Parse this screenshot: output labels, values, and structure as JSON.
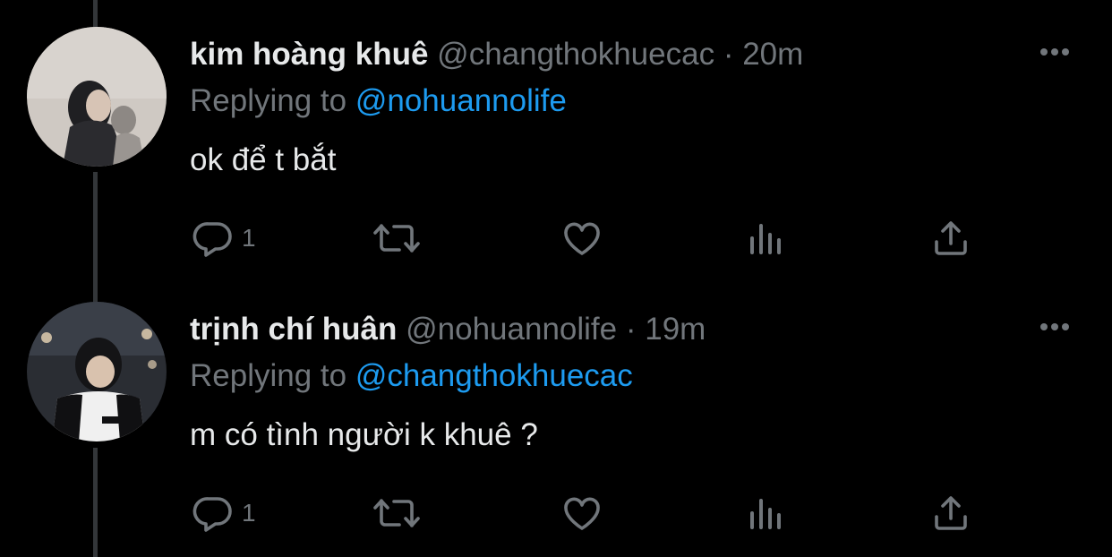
{
  "tweets": [
    {
      "name": "kim hoàng khuê",
      "handle": "@changthokhuecac",
      "separator": "·",
      "time": "20m",
      "replying_prefix": "Replying to",
      "replying_to": "@nohuannolife",
      "text": "ok để t bắt",
      "reply_count": "1",
      "icons": {
        "more": "more-icon",
        "reply": "reply-icon",
        "retweet": "retweet-icon",
        "like": "heart-icon",
        "analytics": "analytics-icon",
        "share": "share-icon"
      }
    },
    {
      "name": "trịnh chí huân",
      "handle": "@nohuannolife",
      "separator": "·",
      "time": "19m",
      "replying_prefix": "Replying to",
      "replying_to": "@changthokhuecac",
      "text": "m có tình người k khuê ?",
      "reply_count": "1",
      "icons": {
        "more": "more-icon",
        "reply": "reply-icon",
        "retweet": "retweet-icon",
        "like": "heart-icon",
        "analytics": "analytics-icon",
        "share": "share-icon"
      }
    }
  ],
  "colors": {
    "background": "#000000",
    "text_primary": "#e7e9ea",
    "text_secondary": "#71767b",
    "link": "#1d9bf0",
    "thread_line": "#333639"
  }
}
